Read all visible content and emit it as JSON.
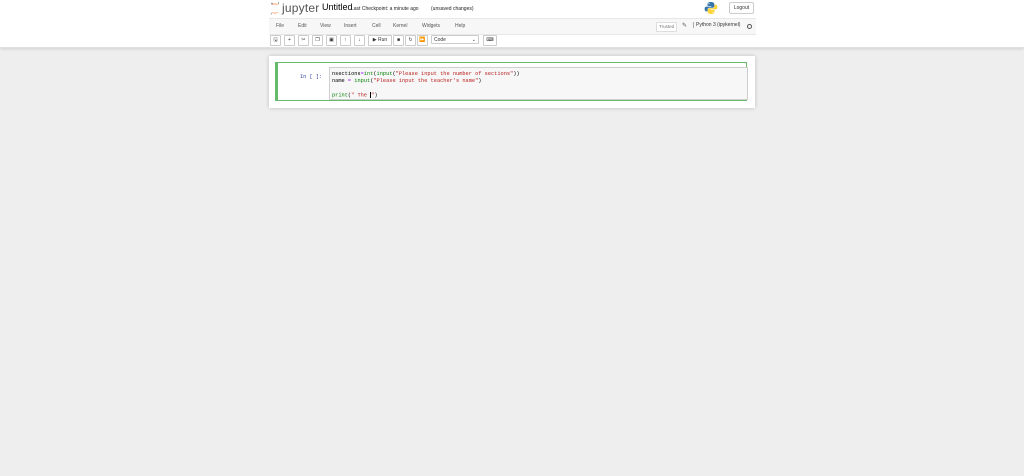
{
  "header": {
    "logo_text": "jupyter",
    "notebook_name": "Untitled",
    "checkpoint": "Last Checkpoint: a minute ago",
    "unsaved": "(unsaved changes)",
    "logout_label": "Logout"
  },
  "menu": {
    "items": [
      "File",
      "Edit",
      "View",
      "Insert",
      "Cell",
      "Kernel",
      "Widgets",
      "Help"
    ],
    "trusted": "Trusted",
    "kernel_name": "Python 3 (ipykernel)"
  },
  "toolbar": {
    "run_label": "Run",
    "cell_type": "Code"
  },
  "cell": {
    "prompt": "In [ ]:",
    "lines": [
      [
        "nsections",
        "=",
        "int",
        "(",
        "input",
        "(",
        "\"Please input the number of sections\"",
        "))"
      ],
      [
        "name ",
        "=",
        " ",
        "input",
        "(",
        "\"Please input the teacher's name\"",
        ")"
      ],
      [],
      [
        "print",
        "(",
        "\" The ",
        "\"",
        ")"
      ]
    ]
  },
  "colors": {
    "edit_border": "#66bb6a",
    "prompt": "#303f9f",
    "keyword": "#008000",
    "string": "#ba2121"
  }
}
